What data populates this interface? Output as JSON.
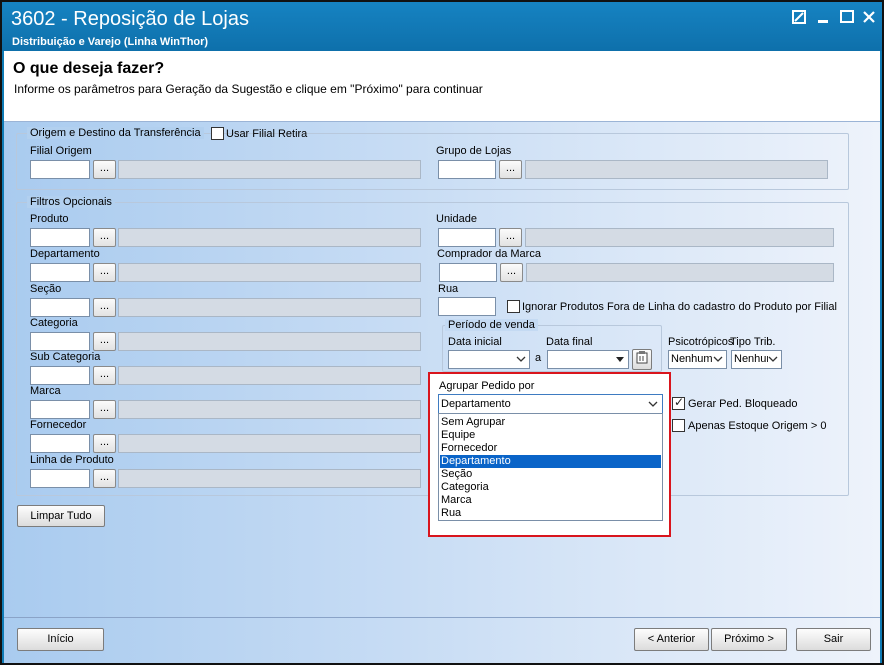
{
  "window": {
    "title": "3602 - Reposição de Lojas",
    "subtitle": "Distribuição e Varejo (Linha WinThor)"
  },
  "header": {
    "title": "O que deseja fazer?",
    "instruction": "Informe os parâmetros para Geração da Sugestão e clique em \"Próximo\" para continuar"
  },
  "origem": {
    "legend": "Origem e Destino da Transferência",
    "usar_filial_retira": "Usar Filial Retira",
    "filial_origem": "Filial Origem",
    "grupo_lojas": "Grupo de Lojas"
  },
  "filtros": {
    "legend": "Filtros Opcionais",
    "produto": "Produto",
    "departamento": "Departamento",
    "secao": "Seção",
    "categoria": "Categoria",
    "subcategoria": "Sub Categoria",
    "marca": "Marca",
    "fornecedor": "Fornecedor",
    "linha_produto": "Linha de Produto",
    "unidade": "Unidade",
    "comprador_marca": "Comprador da Marca",
    "rua": "Rua",
    "ignorar_fora_linha": "Ignorar Produtos Fora de Linha do cadastro do Produto por Filial",
    "periodo_venda": "Período de venda",
    "data_inicial": "Data inicial",
    "data_final": "Data final",
    "separador_a": "a",
    "psicotropicos": "Psicotrópicos",
    "psicotropicos_value": "Nenhum",
    "tipo_trib": "Tipo Trib.",
    "tipo_trib_value": "Nenhum",
    "gerar_ped_bloqueado": "Gerar Ped. Bloqueado",
    "apenas_estoque": "Apenas Estoque Origem > 0"
  },
  "agrupar": {
    "label": "Agrupar Pedido por",
    "selected": "Departamento",
    "options": [
      "Sem Agrupar",
      "Equipe",
      "Fornecedor",
      "Departamento",
      "Seção",
      "Categoria",
      "Marca",
      "Rua"
    ]
  },
  "buttons": {
    "dots": "...",
    "limpar_tudo": "Limpar Tudo",
    "inicio": "Início",
    "anterior": "< Anterior",
    "proximo": "Próximo >",
    "sair": "Sair"
  },
  "colors": {
    "titlebar": "#0e70ab",
    "highlight": "#d9151d",
    "selection": "#0a64c8"
  }
}
